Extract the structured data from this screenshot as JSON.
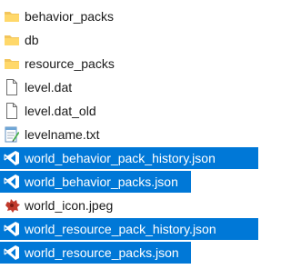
{
  "files": [
    {
      "name": "behavior_packs",
      "icon": "folder-icon",
      "selected": false
    },
    {
      "name": "db",
      "icon": "folder-icon",
      "selected": false
    },
    {
      "name": "resource_packs",
      "icon": "folder-icon",
      "selected": false
    },
    {
      "name": "level.dat",
      "icon": "blank-file-icon",
      "selected": false
    },
    {
      "name": "level.dat_old",
      "icon": "blank-file-icon",
      "selected": false
    },
    {
      "name": "levelname.txt",
      "icon": "notepad-text-file-icon",
      "selected": false
    },
    {
      "name": "world_behavior_pack_history.json",
      "icon": "vscode-json-file-icon",
      "selected": true
    },
    {
      "name": "world_behavior_packs.json",
      "icon": "vscode-json-file-icon",
      "selected": true
    },
    {
      "name": "world_icon.jpeg",
      "icon": "image-file-icon",
      "selected": false
    },
    {
      "name": "world_resource_pack_history.json",
      "icon": "vscode-json-file-icon",
      "selected": true
    },
    {
      "name": "world_resource_packs.json",
      "icon": "vscode-json-file-icon",
      "selected": true
    }
  ],
  "colors": {
    "selection": "#0078d7",
    "folder": "#f2c55c",
    "vscode_blue": "#0065a9"
  }
}
